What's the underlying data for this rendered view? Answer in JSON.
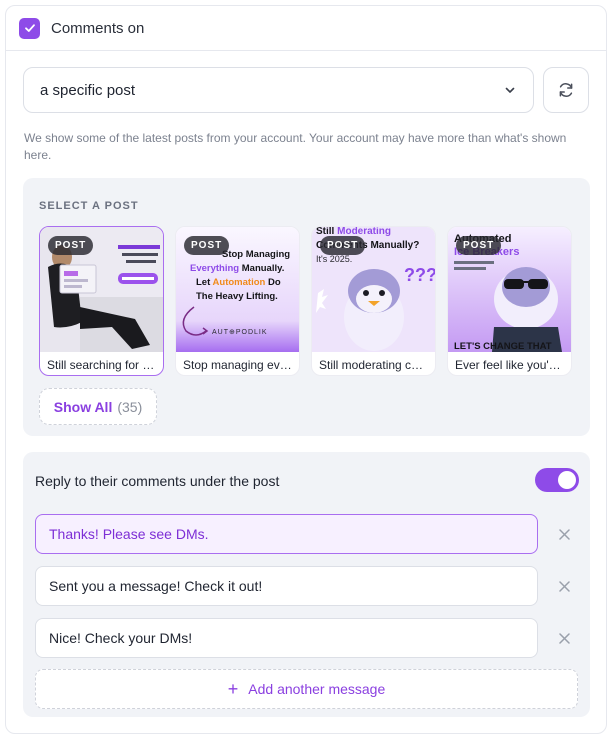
{
  "header": {
    "checkbox_checked": true,
    "label": "Comments on"
  },
  "post_filter": {
    "selected": "a specific post"
  },
  "helper_text": "We show some of the latest posts from your account. Your account may have more than what's shown here.",
  "posts_section": {
    "title": "SELECT A POST",
    "badge": "POST",
    "posts": [
      {
        "caption": "Still searching for the right tool?",
        "selected": true
      },
      {
        "caption": "Stop managing everything manually",
        "selected": false
      },
      {
        "caption": "Still moderating comments manually?",
        "selected": false
      },
      {
        "caption": "Ever feel like you're missing out?",
        "selected": false
      }
    ],
    "show_all_label": "Show All",
    "show_all_count": "(35)"
  },
  "reply_section": {
    "title": "Reply to their comments under the post",
    "toggle_on": true,
    "messages": [
      "Thanks! Please see DMs.",
      "Sent you a message! Check it out!",
      "Nice! Check your DMs!"
    ],
    "add_label": "Add another message"
  },
  "thumb_text": {
    "p2": {
      "l1": "Stop Managing",
      "l2a": "Everything",
      "l2b": " Manually.",
      "l3a": "Let ",
      "l3b": "Automation",
      "l3c": " Do",
      "l4": "The Heavy Lifting.",
      "logo": "AUT⊕PODLIK"
    },
    "p3": {
      "l1a": "Still ",
      "l1b": "Moderating",
      "l2": "Comments Manually?",
      "l3": "It's 2025."
    },
    "p4": {
      "l1": "Automated",
      "l2": "Ice Breakers",
      "l3": "LET'S CHANGE THAT"
    }
  },
  "colors": {
    "accent": "#8e4be8",
    "accent_text": "#8a3fe0",
    "panel": "#f1f3f7"
  }
}
